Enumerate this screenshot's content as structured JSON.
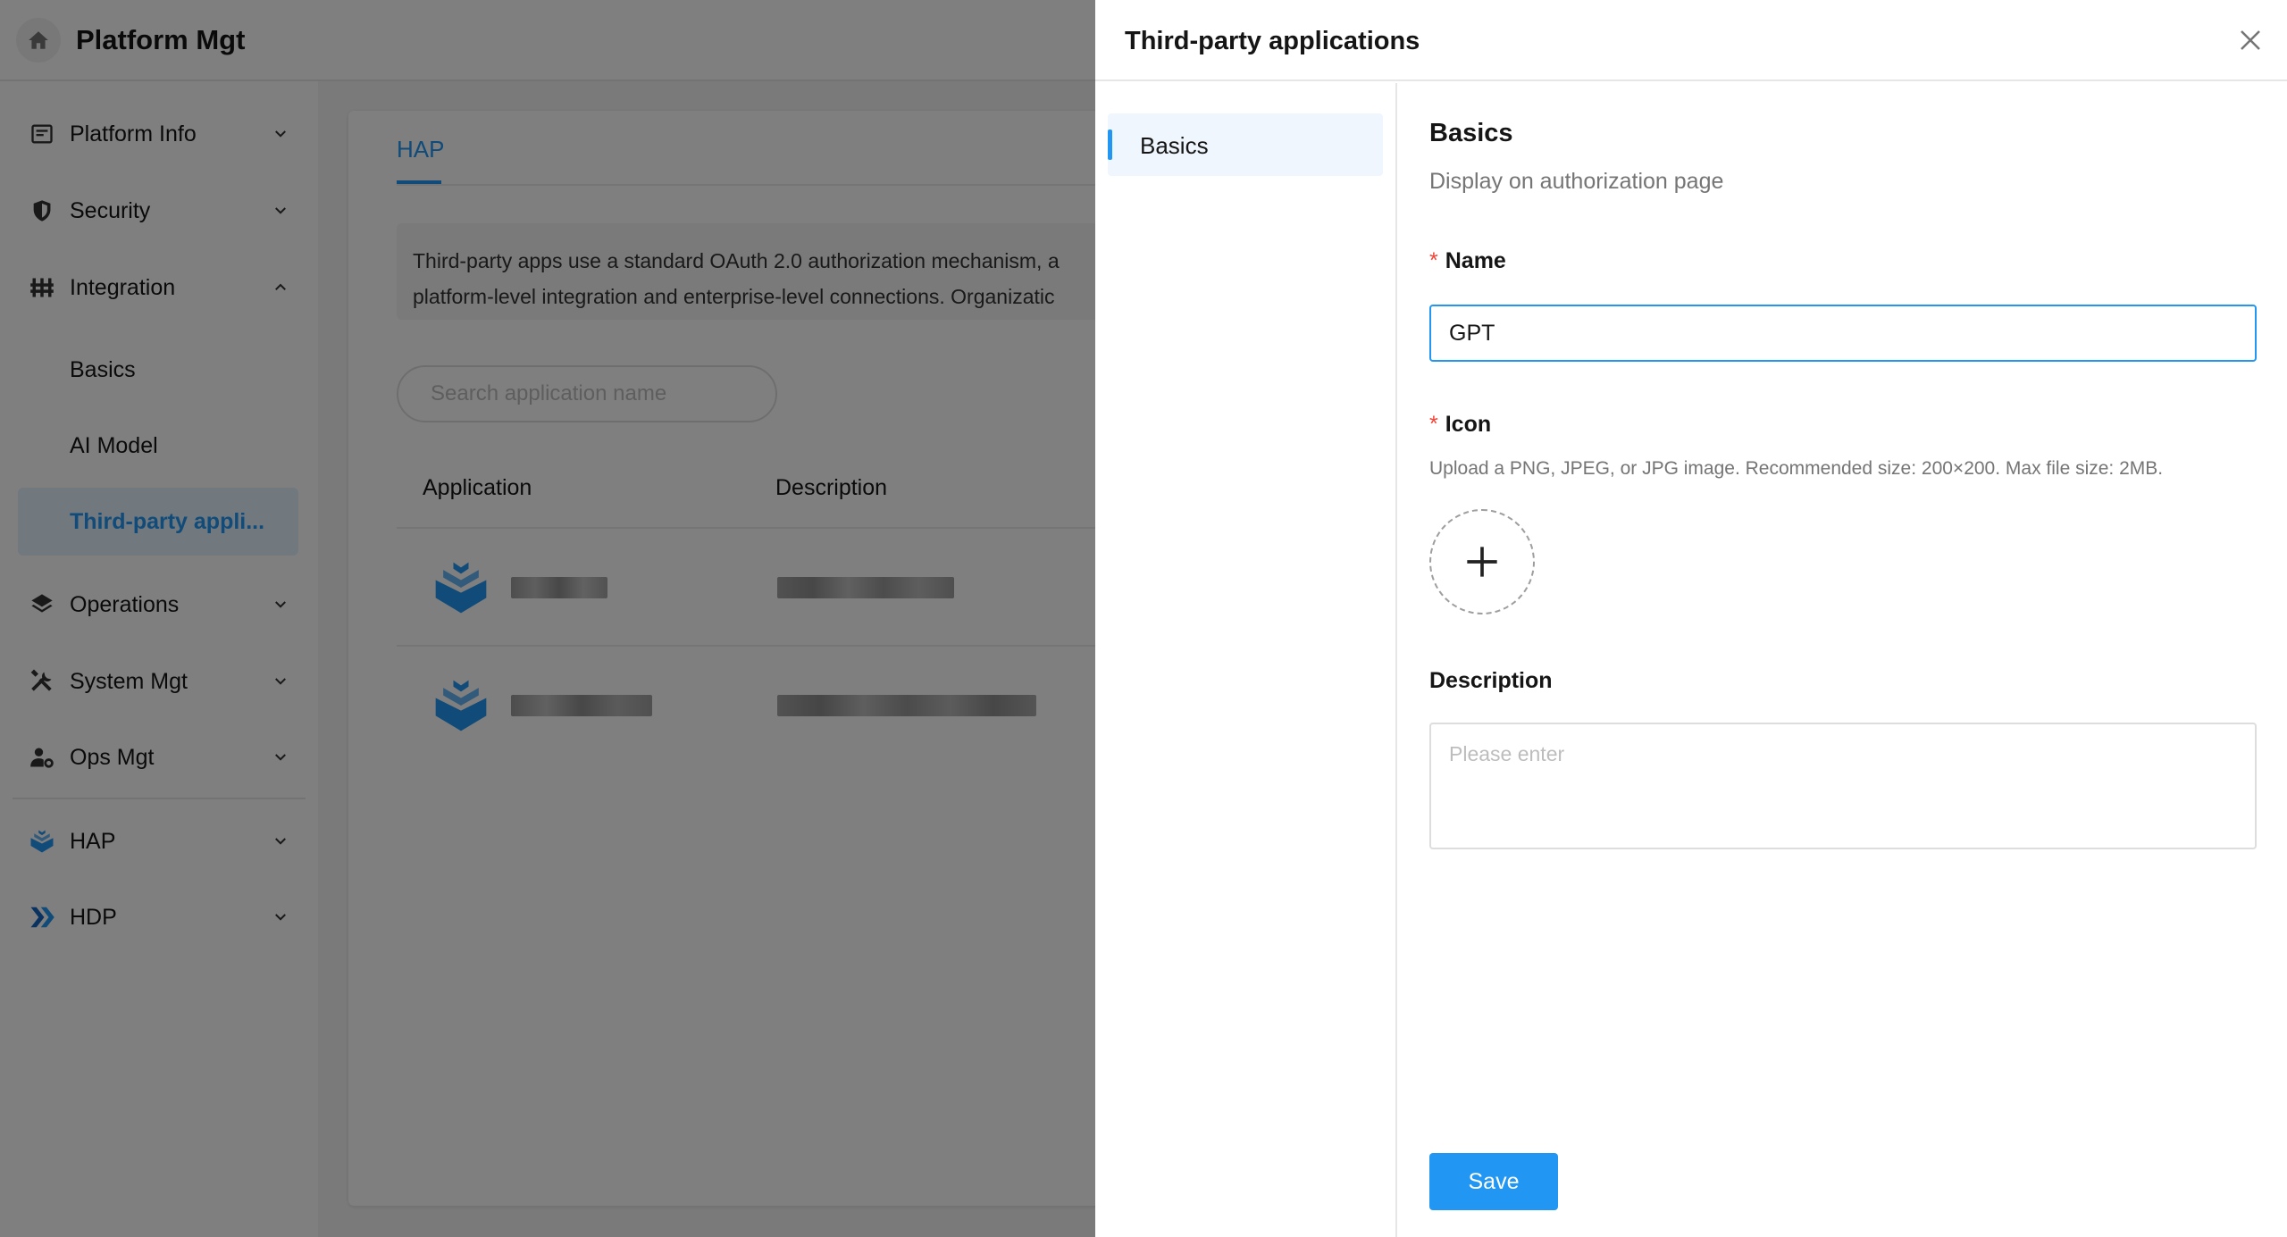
{
  "header": {
    "title": "Platform Mgt",
    "home_icon": "home-icon"
  },
  "sidebar": {
    "items": [
      {
        "label": "Platform Info",
        "icon": "document-icon",
        "expanded": false
      },
      {
        "label": "Security",
        "icon": "shield-icon",
        "expanded": false
      },
      {
        "label": "Integration",
        "icon": "sliders-icon",
        "expanded": true,
        "children": [
          {
            "label": "Basics",
            "active": false
          },
          {
            "label": "AI Model",
            "active": false
          },
          {
            "label": "Third-party appli...",
            "active": true
          }
        ]
      },
      {
        "label": "Operations",
        "icon": "layers-icon",
        "expanded": false
      },
      {
        "label": "System Mgt",
        "icon": "tools-icon",
        "expanded": false
      },
      {
        "label": "Ops Mgt",
        "icon": "user-gear-icon",
        "expanded": false
      },
      {
        "label": "HAP",
        "icon": "hap-logo-icon",
        "expanded": false
      },
      {
        "label": "HDP",
        "icon": "hdp-logo-icon",
        "expanded": false
      }
    ]
  },
  "main": {
    "tab": "HAP",
    "info_line1": "Third-party apps use a standard OAuth 2.0 authorization mechanism, a",
    "info_line2": "platform-level integration and enterprise-level connections. Organizatic",
    "search_placeholder": "Search application name",
    "columns": [
      "Application",
      "Description"
    ]
  },
  "drawer": {
    "title": "Third-party applications",
    "side_item": "Basics",
    "section_title": "Basics",
    "section_sub": "Display on authorization page",
    "name_label": "Name",
    "name_value": "GPT",
    "icon_label": "Icon",
    "icon_hint": "Upload a PNG, JPEG, or JPG image. Recommended size: 200×200. Max file size: 2MB.",
    "description_label": "Description",
    "description_placeholder": "Please enter",
    "save_label": "Save"
  },
  "colors": {
    "accent": "#2196f3",
    "required": "#f44336",
    "overlay": "rgba(0,0,0,0.5)"
  }
}
